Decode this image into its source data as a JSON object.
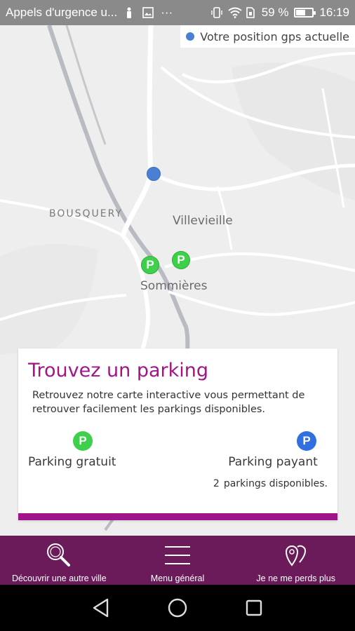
{
  "statusbar": {
    "app_title": "Appels d'urgence u...",
    "more": "···",
    "battery": "59 %",
    "battery_level": 0.59,
    "time": "16:19"
  },
  "map": {
    "gps_legend": "Votre position gps actuelle",
    "labels": {
      "bousquery": "BOUSQUERY",
      "villevieille": "Villevieille",
      "sommieres": "Sommières"
    },
    "parking_marker_letter": "P"
  },
  "card": {
    "title": "Trouvez un parking",
    "description": "Retrouvez notre carte interactive vous permettant de retrouver facilement les parkings disponibles.",
    "free": {
      "icon": "P",
      "label": "Parking gratuit"
    },
    "paid": {
      "icon": "P",
      "label": "Parking payant"
    },
    "count_number": "2",
    "count_text": "parkings disponibles.",
    "accent": "#a0158a"
  },
  "bottomnav": {
    "items": [
      {
        "icon": "magnifier-icon",
        "label": "Découvrir une autre ville"
      },
      {
        "icon": "hamburger-menu-icon",
        "label": "Menu général"
      },
      {
        "icon": "map-pins-icon",
        "label": "Je ne me perds plus"
      }
    ],
    "background": "#6b1a5a"
  }
}
